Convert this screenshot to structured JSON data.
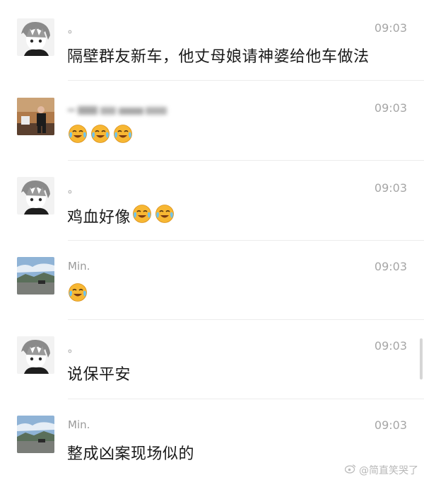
{
  "messages": [
    {
      "name": "。",
      "time": "09:03",
      "text": "隔壁群友新车，他丈母娘请神婆给他车做法",
      "avatar": "anime-avatar-icon"
    },
    {
      "name": "",
      "time": "09:03",
      "text": "",
      "avatar": "photo-avatar-man-icon",
      "emoji_count": 3
    },
    {
      "name": "。",
      "time": "09:03",
      "text": "鸡血好像",
      "avatar": "anime-avatar-icon",
      "emoji_count": 2
    },
    {
      "name": "Min.",
      "time": "09:03",
      "text": "",
      "avatar": "landscape-avatar-icon",
      "emoji_count": 1
    },
    {
      "name": "。",
      "time": "09:03",
      "text": "说保平安",
      "avatar": "anime-avatar-icon"
    },
    {
      "name": "Min.",
      "time": "09:03",
      "text": "整成凶案现场似的",
      "avatar": "landscape-avatar-icon"
    }
  ],
  "watermark": "@简直笑哭了",
  "colors": {
    "emoji_face": "#f7b733",
    "emoji_tears": "#6cc3f0",
    "divider": "#ececec"
  }
}
